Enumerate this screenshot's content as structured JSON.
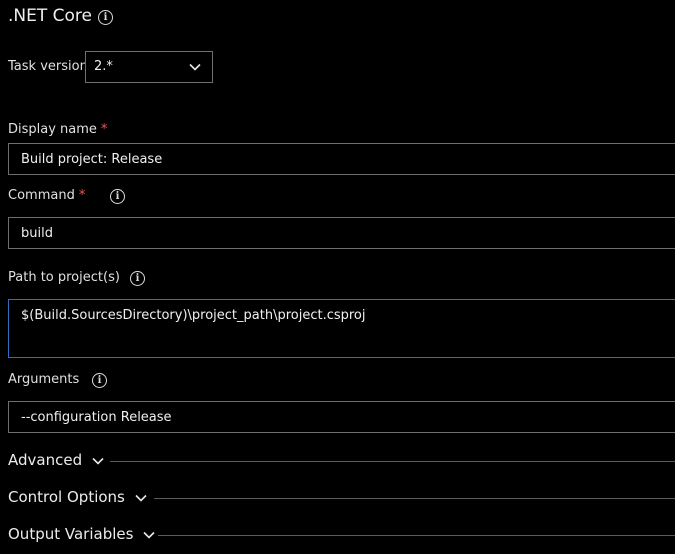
{
  "task": {
    "title": ".NET Core"
  },
  "task_version": {
    "label": "Task version",
    "value": "2.*"
  },
  "fields": {
    "display_name": {
      "label": "Display name",
      "required_mark": "*",
      "value": "Build project: Release"
    },
    "command": {
      "label": "Command",
      "required_mark": "*",
      "value": "build"
    },
    "path_to_projects": {
      "label": "Path to project(s)",
      "value": "$(Build.SourcesDirectory)\\project_path\\project.csproj"
    },
    "arguments": {
      "label": "Arguments",
      "value": "--configuration Release"
    }
  },
  "sections": {
    "advanced": "Advanced",
    "control_options": "Control Options",
    "output_variables": "Output Variables"
  },
  "icons": {
    "info": "info-icon",
    "chevron": "chevron-down-icon"
  },
  "colors": {
    "background": "#000000",
    "text": "#e8e8e8",
    "required": "#f05a5a",
    "input_border": "#6e6e6e",
    "focus_border": "#2e6fbf"
  }
}
